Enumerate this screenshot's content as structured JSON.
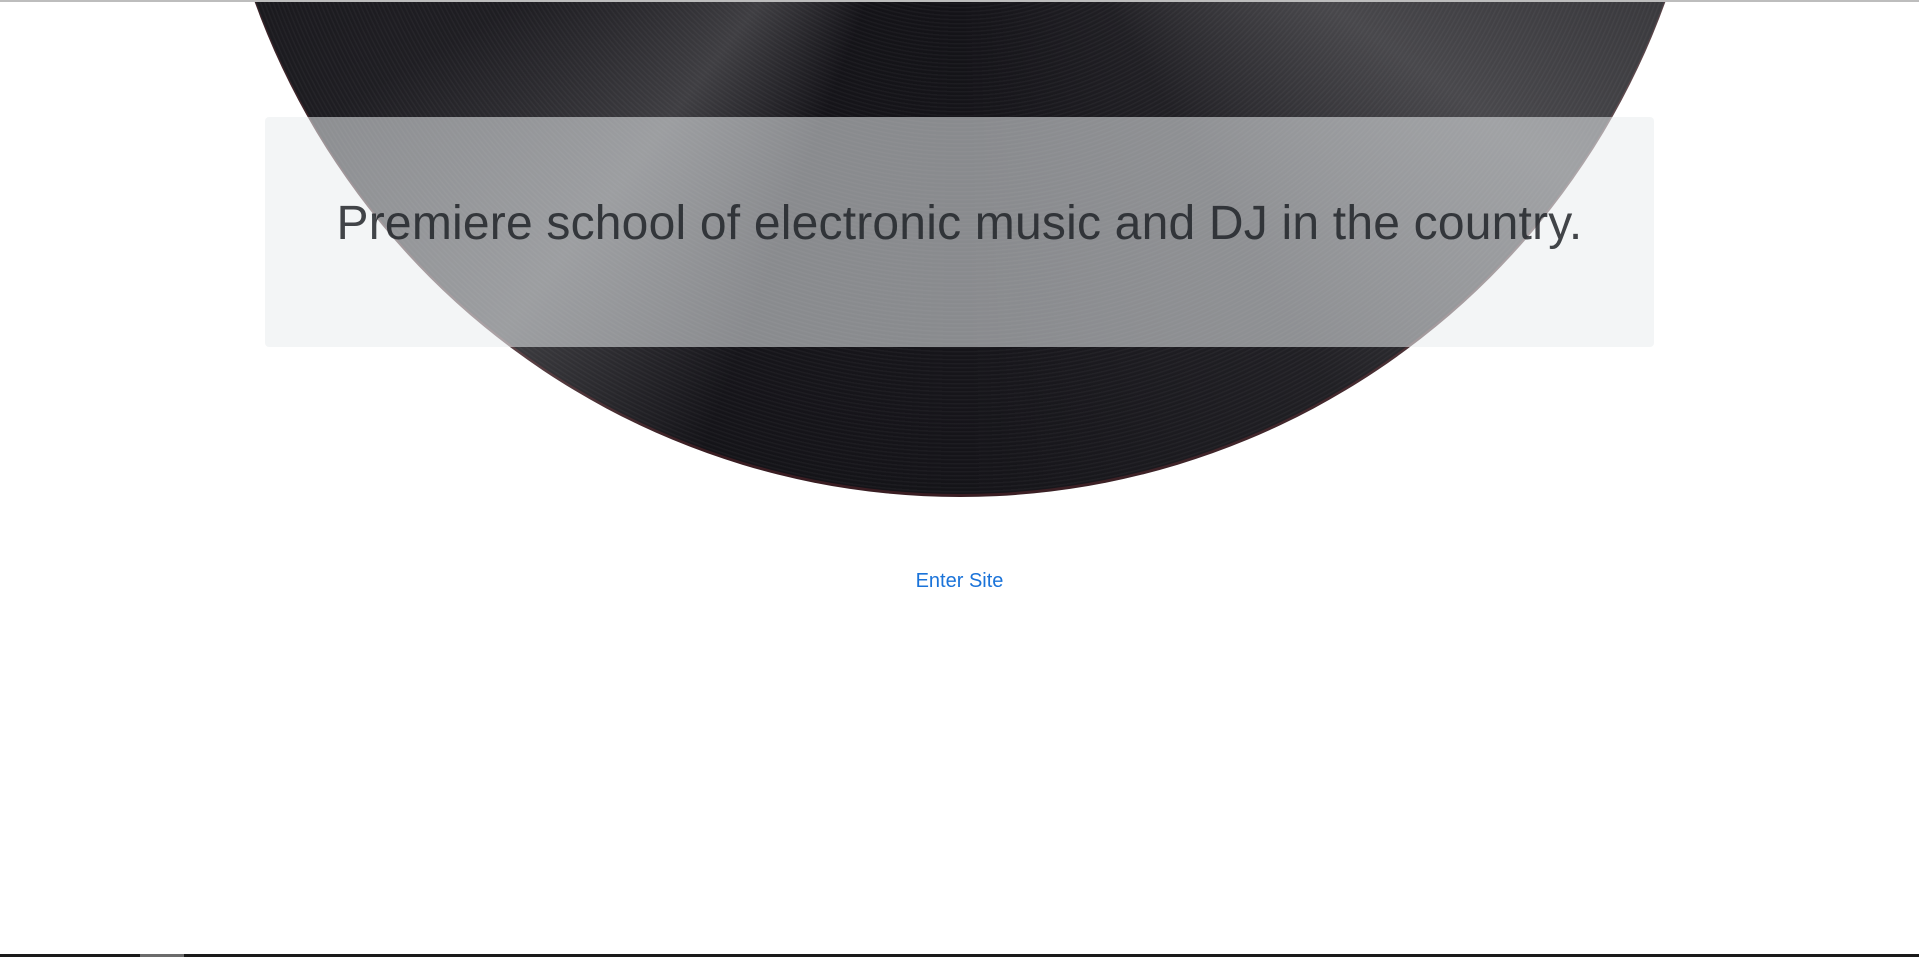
{
  "hero": {
    "tagline": "Premiere school of electronic music and DJ in the country."
  },
  "actions": {
    "enter_label": "Enter Site"
  },
  "colors": {
    "link": "#1a73d9",
    "record": "#131217",
    "panel": "#e9ecef"
  }
}
